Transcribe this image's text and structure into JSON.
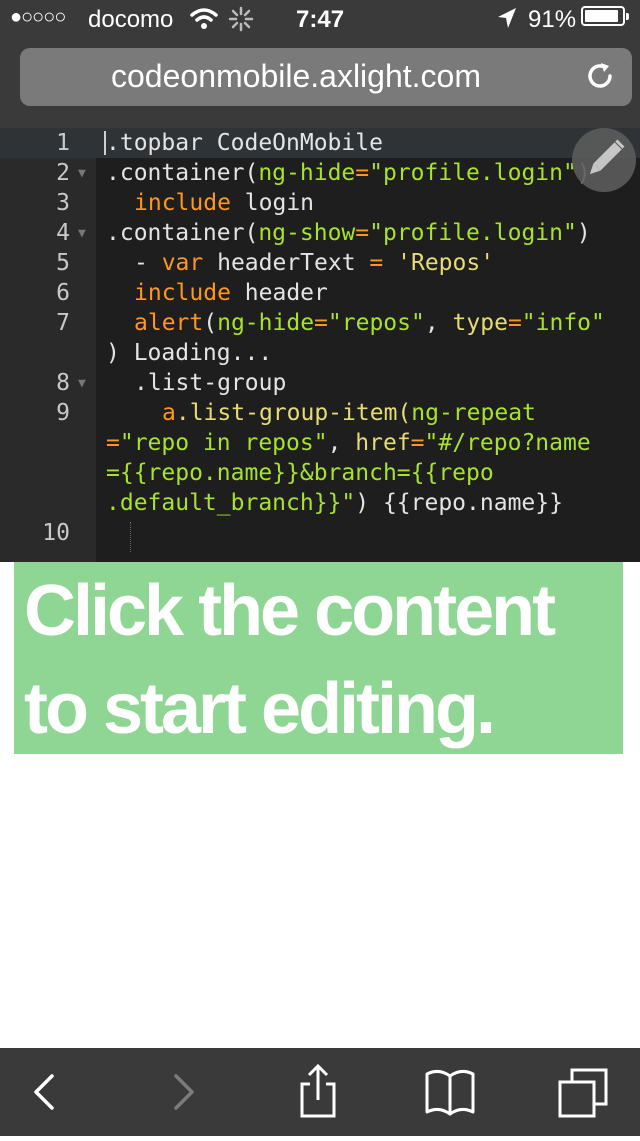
{
  "status_bar": {
    "signal": "●○○○○",
    "carrier": "docomo",
    "time": "7:47",
    "battery": "91%",
    "battery_level": 0.91
  },
  "browser": {
    "url": "codeonmobile.axlight.com"
  },
  "editor": {
    "lines": [
      {
        "num": "1",
        "fold": false
      },
      {
        "num": "2",
        "fold": true
      },
      {
        "num": "3",
        "fold": false
      },
      {
        "num": "4",
        "fold": true
      },
      {
        "num": "5",
        "fold": false
      },
      {
        "num": "6",
        "fold": false
      },
      {
        "num": "7",
        "fold": false
      },
      {
        "num": "8",
        "fold": true
      },
      {
        "num": "9",
        "fold": false
      },
      {
        "num": "10",
        "fold": false
      }
    ],
    "code": {
      "l1": ".topbar CodeOnMobile",
      "l2a": ".container(",
      "l2b": "ng-hide",
      "l2c": "=",
      "l2d": "\"profile.login\"",
      "l2e": ")",
      "l3a": "include",
      "l3b": " login",
      "l4a": ".container(",
      "l4b": "ng-show",
      "l4c": "=",
      "l4d": "\"profile.login\"",
      "l4e": ")",
      "l5a": "- ",
      "l5b": "var",
      "l5c": " headerText ",
      "l5d": "=",
      "l5e": " 'Repos'",
      "l6a": "include",
      "l6b": " header",
      "l7a": "alert",
      "l7b": "(",
      "l7c": "ng-hide",
      "l7d": "=",
      "l7e": "\"repos\"",
      "l7f": ", ",
      "l7g": "type",
      "l7h": "=",
      "l7i": "\"info\"",
      "l7wrap": ") Loading...",
      "l8": ".list-group",
      "l9a": "a",
      "l9b": ".list-group-item(",
      "l9c": "ng-repeat",
      "l9w1a": "=",
      "l9w1b": "\"repo in repos\"",
      "l9w1c": ", ",
      "l9w1d": "href",
      "l9w1e": "=",
      "l9w1f": "\"#/repo?name",
      "l9w2": "={{repo.name}}&branch={{repo",
      "l9w3a": ".default_branch}}\"",
      "l9w3b": ") {{repo.name}}"
    }
  },
  "banner": {
    "text": "Click the content to start editing."
  },
  "icons": {
    "edit": "pencil-icon",
    "reload": "reload-icon",
    "back": "back-icon",
    "forward": "forward-icon",
    "share": "share-icon",
    "bookmarks": "bookmarks-icon",
    "tabs": "tabs-icon"
  }
}
